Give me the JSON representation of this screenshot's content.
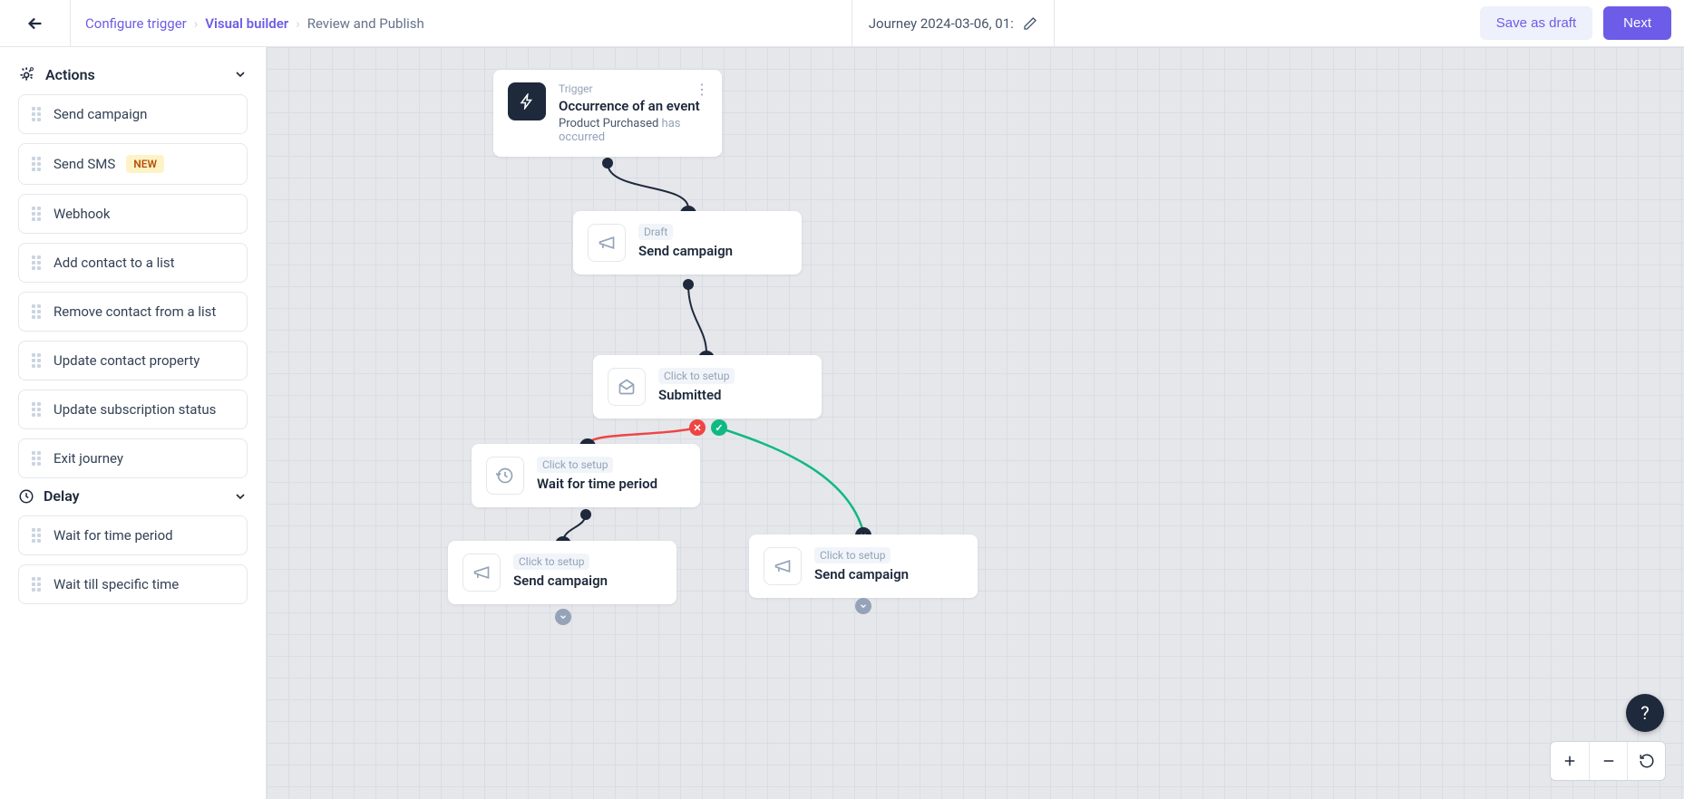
{
  "header": {
    "crumbs": [
      "Configure trigger",
      "Visual builder",
      "Review and Publish"
    ],
    "active_crumb_index": 1,
    "title": "Journey 2024-03-06, 01:",
    "save_draft": "Save as draft",
    "next": "Next"
  },
  "sidebar": {
    "sections": [
      {
        "title": "Actions",
        "icon": "gear-plus",
        "items": [
          {
            "label": "Send campaign",
            "badge": null
          },
          {
            "label": "Send SMS",
            "badge": "NEW"
          },
          {
            "label": "Webhook",
            "badge": null
          },
          {
            "label": "Add contact to a list",
            "badge": null
          },
          {
            "label": "Remove contact from a list",
            "badge": null
          },
          {
            "label": "Update contact property",
            "badge": null
          },
          {
            "label": "Update subscription status",
            "badge": null
          },
          {
            "label": "Exit journey",
            "badge": null
          }
        ]
      },
      {
        "title": "Delay",
        "icon": "clock",
        "items": [
          {
            "label": "Wait for time period",
            "badge": null
          },
          {
            "label": "Wait till specific time",
            "badge": null
          }
        ]
      }
    ]
  },
  "nodes": {
    "trigger": {
      "tag": "Trigger",
      "title": "Occurrence of an event",
      "event_name": "Product Purchased",
      "event_suffix": "has occurred"
    },
    "send1": {
      "tag": "Draft",
      "title": "Send campaign"
    },
    "submitted": {
      "tag": "Click to setup",
      "title": "Submitted"
    },
    "wait": {
      "tag": "Click to setup",
      "title": "Wait for time period"
    },
    "send_left": {
      "tag": "Click to setup",
      "title": "Send campaign"
    },
    "send_right": {
      "tag": "Click to setup",
      "title": "Send campaign"
    }
  },
  "help_label": "?"
}
